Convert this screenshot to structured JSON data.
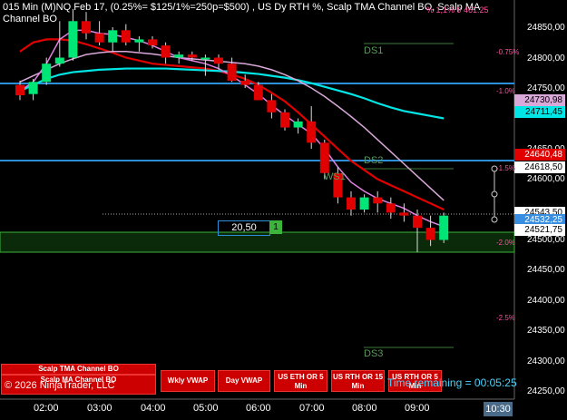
{
  "header": {
    "title": "015 Min (M)NQ Feb 17, (0.25%= $125/1%=250p=$500) , US Dy RTH %, Scalp TMA Channel BO, Scalp MA Channel BO",
    "top_right": "% 1,1% 9 461.25"
  },
  "price_axis": [
    "24850,00",
    "24800,00",
    "24750,00",
    "24650,00",
    "24600,00",
    "24500,00",
    "24450,00",
    "24400,00",
    "24350,00",
    "24300,00",
    "24250,00"
  ],
  "price_tags": [
    {
      "label": "24730,98",
      "color": "#d8a8d8"
    },
    {
      "label": "24711,45",
      "color": "#00e5e5"
    },
    {
      "label": "24640,48",
      "color": "#e00000"
    },
    {
      "label": "24618,50",
      "color": "#ffffff"
    },
    {
      "label": "24543,50",
      "color": "#ffffff"
    },
    {
      "label": "24532,25",
      "color": "#3a8ee0"
    },
    {
      "label": "24521,75",
      "color": "#ffffff"
    }
  ],
  "time_axis": [
    "02:00",
    "03:00",
    "04:00",
    "05:00",
    "06:00",
    "07:00",
    "08:00",
    "09:00"
  ],
  "time_clock": "10:30",
  "percent_labels": [
    "-0.75%",
    "-1.0%",
    "-1.5%",
    "-2.0%",
    "-2.5%"
  ],
  "level_labels": [
    "DS1",
    "DS2",
    "WS1",
    "DS3"
  ],
  "range_box": {
    "value": "20,50",
    "count": "1"
  },
  "buttons": [
    {
      "label": "Scalp TMA Channel BO"
    },
    {
      "label": "Scalp MA Channel BO"
    },
    {
      "label": "Wkly VWAP"
    },
    {
      "label": "Day VWAP"
    },
    {
      "label": "US ETH OR 5 Min"
    },
    {
      "label": "US RTH OR 15 Min"
    },
    {
      "label": "US RTH OR 5 Min"
    }
  ],
  "copyright": "© 2026 NinjaTrader, LLC",
  "time_remaining": "Time remaining = 00:05:25",
  "colors": {
    "up": "#00e676",
    "down": "#e00000",
    "accent": "#2d8fd8",
    "cyan": "#00e5e5",
    "pink": "#d8a8d8"
  },
  "chart_data": {
    "type": "candlestick",
    "x": [
      "01:45",
      "02:00",
      "02:15",
      "02:30",
      "02:45",
      "03:00",
      "03:15",
      "03:30",
      "03:45",
      "04:00",
      "04:15",
      "04:30",
      "04:45",
      "05:00",
      "05:15",
      "05:30",
      "05:45",
      "06:00",
      "06:15",
      "06:30",
      "06:45",
      "07:00",
      "07:15",
      "07:30",
      "07:45",
      "08:00",
      "08:15",
      "08:30",
      "08:45",
      "09:00",
      "09:15",
      "09:30",
      "09:45"
    ],
    "ohlc": [
      [
        24755,
        24762,
        24730,
        24738
      ],
      [
        24740,
        24765,
        24730,
        24760
      ],
      [
        24760,
        24800,
        24755,
        24790
      ],
      [
        24790,
        24860,
        24785,
        24800
      ],
      [
        24800,
        24880,
        24795,
        24860
      ],
      [
        24860,
        24875,
        24830,
        24840
      ],
      [
        24840,
        24860,
        24820,
        24825
      ],
      [
        24825,
        24850,
        24810,
        24845
      ],
      [
        24845,
        24855,
        24820,
        24825
      ],
      [
        24825,
        24835,
        24810,
        24830
      ],
      [
        24830,
        24835,
        24815,
        24820
      ],
      [
        24820,
        24825,
        24790,
        24800
      ],
      [
        24800,
        24810,
        24790,
        24805
      ],
      [
        24805,
        24810,
        24795,
        24800
      ],
      [
        24800,
        24805,
        24770,
        24800
      ],
      [
        24800,
        24805,
        24780,
        24790
      ],
      [
        24790,
        24800,
        24760,
        24762
      ],
      [
        24762,
        24772,
        24750,
        24755
      ],
      [
        24755,
        24760,
        24730,
        24730
      ],
      [
        24730,
        24740,
        24700,
        24710
      ],
      [
        24710,
        24715,
        24680,
        24685
      ],
      [
        24685,
        24700,
        24675,
        24695
      ],
      [
        24695,
        24720,
        24650,
        24660
      ],
      [
        24660,
        24665,
        24600,
        24610
      ],
      [
        24610,
        24620,
        24560,
        24570
      ],
      [
        24570,
        24580,
        24540,
        24550
      ],
      [
        24550,
        24575,
        24545,
        24570
      ],
      [
        24570,
        24580,
        24545,
        24560
      ],
      [
        24560,
        24570,
        24535,
        24545
      ],
      [
        24545,
        24560,
        24530,
        24540
      ],
      [
        24540,
        24550,
        24480,
        24520
      ],
      [
        24520,
        24540,
        24490,
        24500
      ],
      [
        24500,
        24545,
        24495,
        24540
      ]
    ],
    "ylim": [
      24240,
      24880
    ],
    "series": [
      {
        "color": "#e00000",
        "values": [
          24810,
          24825,
          24830,
          24830,
          24828,
          24822,
          24815,
          24808,
          24800,
          24795,
          24790,
          24788,
          24786,
          24784,
          24782,
          24778,
          24772,
          24765,
          24755,
          24742,
          24728,
          24710,
          24690,
          24670,
          24650,
          24630,
          24615,
          24600,
          24590,
          24580,
          24570,
          24560,
          24550
        ]
      },
      {
        "color": "#00e5e5",
        "values": [
          24745,
          24755,
          24765,
          24772,
          24776,
          24778,
          24780,
          24781,
          24782,
          24782,
          24782,
          24782,
          24781,
          24780,
          24779,
          24778,
          24777,
          24775,
          24773,
          24770,
          24767,
          24763,
          24758,
          24752,
          24746,
          24740,
          24733,
          24725,
          24718,
          24712,
          24708,
          24704,
          24700
        ]
      },
      {
        "color": "#d8a8d8",
        "values": [
          24760,
          24770,
          24780,
          24790,
          24798,
          24805,
          24808,
          24810,
          24810,
          24808,
          24806,
          24803,
          24800,
          24798,
          24796,
          24794,
          24792,
          24790,
          24786,
          24780,
          24772,
          24762,
          24750,
          24736,
          24720,
          24703,
          24685,
          24665,
          24645,
          24625,
          24605,
          24585,
          24565
        ]
      },
      {
        "color": "#e080e0",
        "values": [
          24745,
          24760,
          24790,
          24830,
          24845,
          24845,
          24840,
          24838,
          24833,
          24828,
          24820,
          24810,
          24800,
          24795,
          24790,
          24782,
          24770,
          24755,
          24740,
          24722,
          24705,
          24690,
          24675,
          24650,
          24620,
          24595,
          24580,
          24568,
          24560,
          24552,
          24540,
          24530,
          24522
        ]
      }
    ]
  }
}
